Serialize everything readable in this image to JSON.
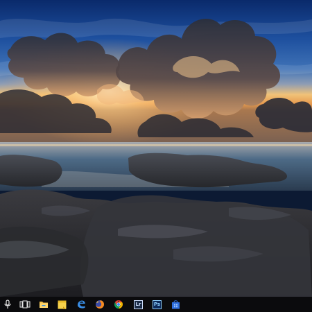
{
  "desktop": {
    "wallpaper_name": "seascape-sunset-rocks"
  },
  "taskbar": {
    "background": "#0b0b0d",
    "items": [
      {
        "name": "microphone-icon",
        "kind": "cortana-voice"
      },
      {
        "name": "task-view-icon",
        "kind": "task-view"
      },
      {
        "name": "file-explorer-icon",
        "kind": "file-explorer"
      },
      {
        "name": "sticky-notes-icon",
        "kind": "sticky-notes"
      },
      {
        "name": "edge-browser-icon",
        "kind": "microsoft-edge"
      },
      {
        "name": "firefox-icon",
        "kind": "firefox"
      },
      {
        "name": "chrome-icon",
        "kind": "google-chrome"
      },
      {
        "name": "lightroom-icon",
        "kind": "adobe-lightroom",
        "label": "Lr"
      },
      {
        "name": "photoshop-icon",
        "kind": "adobe-photoshop",
        "label": "Ps"
      },
      {
        "name": "store-icon",
        "kind": "windows-store"
      }
    ],
    "colors": {
      "lightroom_bg": "#1a2b45",
      "lightroom_fg": "#cfe0ff",
      "photoshop_bg": "#0d2a5a",
      "photoshop_fg": "#8fd0ff",
      "edge": "#3a8ee6",
      "store": "#2f6fe0"
    }
  }
}
